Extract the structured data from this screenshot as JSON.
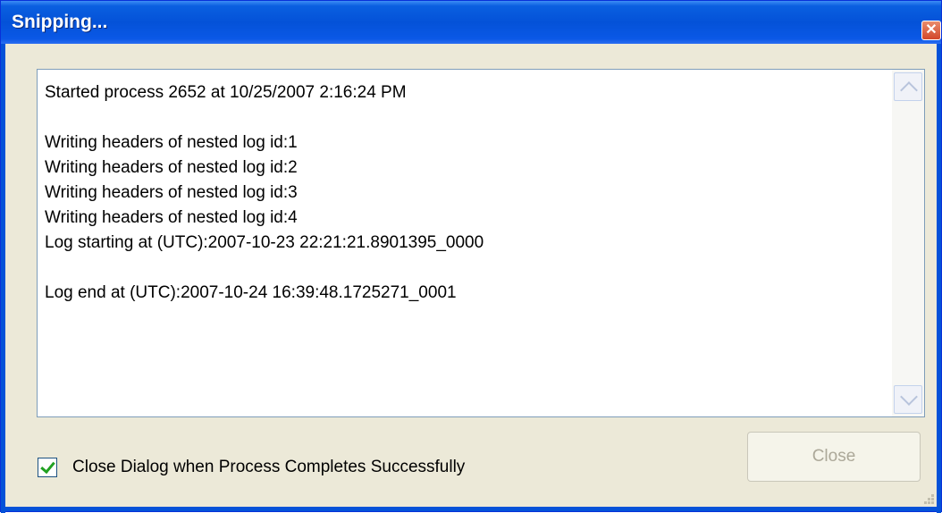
{
  "window": {
    "title": "Snipping...",
    "close_glyph": "✕"
  },
  "log": {
    "lines": [
      "Started process 2652 at 10/25/2007 2:16:24 PM",
      "",
      "Writing headers of nested log id:1",
      "Writing headers of nested log id:2",
      "Writing headers of nested log id:3",
      "Writing headers of nested log id:4",
      "Log starting at (UTC):2007-10-23 22:21:21.8901395_0000",
      "",
      "Log end at (UTC):2007-10-24 16:39:48.1725271_0001"
    ]
  },
  "options": {
    "close_on_success_label": "Close Dialog when Process Completes Successfully",
    "close_on_success_checked": true
  },
  "buttons": {
    "close_label": "Close",
    "close_enabled": false
  },
  "colors": {
    "titlebar": "#0452d8",
    "title_text": "#ffffff",
    "check": "#21a121",
    "disabled_text": "#aca899"
  },
  "icons": {
    "close": "close-icon",
    "scroll_up": "chevron-up-icon",
    "scroll_down": "chevron-down-icon",
    "check": "checkmark-icon",
    "grip": "resize-grip-icon"
  }
}
